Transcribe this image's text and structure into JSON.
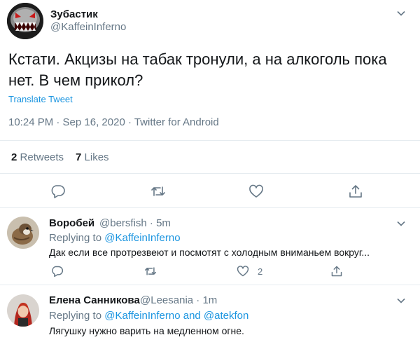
{
  "tweet": {
    "display_name": "Зубастик",
    "handle": "@KaffeinInferno",
    "text_line1": "Кстати. Акцизы на табак тронули, а на алкоголь пока",
    "text_line2": "нет. В чем прикол?",
    "translate_label": "Translate Tweet",
    "timestamp": "10:24 PM · Sep 16, 2020 · Twitter for Android",
    "retweets_count": "2",
    "retweets_label": "Retweets",
    "likes_count": "7",
    "likes_label": "Likes",
    "icons": [
      "reply-icon",
      "retweet-icon",
      "like-icon",
      "share-icon"
    ]
  },
  "replies": [
    {
      "display_name": "Воробей",
      "handle": "@bersfish · 5m",
      "replying_prefix": "Replying to ",
      "replying_to": "@KaffeinInferno",
      "text": "Дак если все протрезвеют и посмотят с холодным вниманьем вокруг...",
      "like_count": "2"
    },
    {
      "display_name": "Елена Санникова",
      "handle": "@Leesania · 1m",
      "replying_prefix": "Replying to ",
      "replying_to": "@KaffeinInferno and @atekfon",
      "text": "Лягушку нужно варить на медленном огне."
    }
  ],
  "colors": {
    "accent": "#1b95e0",
    "secondary_text": "#657786",
    "border": "#e6ecf0"
  }
}
